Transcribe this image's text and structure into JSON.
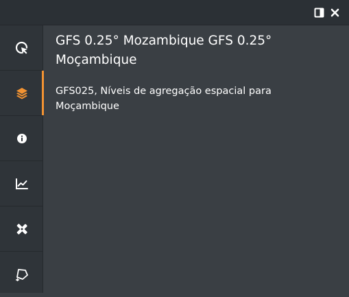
{
  "panel": {
    "title": "GFS 0.25° Mozambique GFS 0.25° Moçambique",
    "description": "GFS025, Níveis de agregação espacial para Moçambique"
  },
  "toolbar": {
    "icons": [
      "panel-toggle-icon",
      "close-icon"
    ]
  },
  "sidebar": {
    "items": [
      {
        "icon": "cursor-click-icon",
        "active": false
      },
      {
        "icon": "layers-icon",
        "active": true
      },
      {
        "icon": "info-icon",
        "active": false
      },
      {
        "icon": "chart-line-icon",
        "active": false
      },
      {
        "icon": "tools-icon",
        "active": false
      },
      {
        "icon": "polygon-icon",
        "active": false
      }
    ]
  },
  "colors": {
    "accent": "#f39332",
    "background": "#3a3f44",
    "sidebar": "#2f3439",
    "topbar": "#2b3035"
  }
}
